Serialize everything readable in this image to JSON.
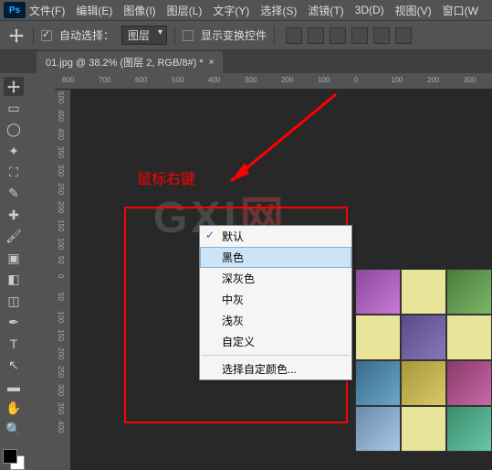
{
  "menubar": {
    "items": [
      "文件(F)",
      "编辑(E)",
      "图像(I)",
      "图层(L)",
      "文字(Y)",
      "选择(S)",
      "滤镜(T)",
      "3D(D)",
      "视图(V)",
      "窗口(W"
    ]
  },
  "optbar": {
    "auto_select_label": "自动选择：",
    "dropdown_value": "图层",
    "show_transform_label": "显示变换控件"
  },
  "tab": {
    "title": "01.jpg @ 38.2% (图层 2, RGB/8#) *",
    "close": "×"
  },
  "ruler_h": [
    "800",
    "700",
    "600",
    "500",
    "400",
    "300",
    "200",
    "100",
    "0",
    "100",
    "200",
    "300"
  ],
  "ruler_v": [
    "500",
    "450",
    "400",
    "350",
    "300",
    "250",
    "200",
    "150",
    "100",
    "50",
    "0",
    "50",
    "100",
    "150",
    "200",
    "250",
    "300",
    "350",
    "400"
  ],
  "annotation": {
    "label": "鼠标右键"
  },
  "context_menu": {
    "items": [
      {
        "label": "默认",
        "checked": true,
        "hl": false
      },
      {
        "label": "黑色",
        "checked": false,
        "hl": true
      },
      {
        "label": "深灰色",
        "checked": false,
        "hl": false
      },
      {
        "label": "中灰",
        "checked": false,
        "hl": false
      },
      {
        "label": "浅灰",
        "checked": false,
        "hl": false
      },
      {
        "label": "自定义",
        "checked": false,
        "hl": false
      }
    ],
    "last_item": "选择自定颜色..."
  },
  "watermark": {
    "t1": "GXI",
    "t2": "网"
  },
  "ps_logo": "Ps"
}
